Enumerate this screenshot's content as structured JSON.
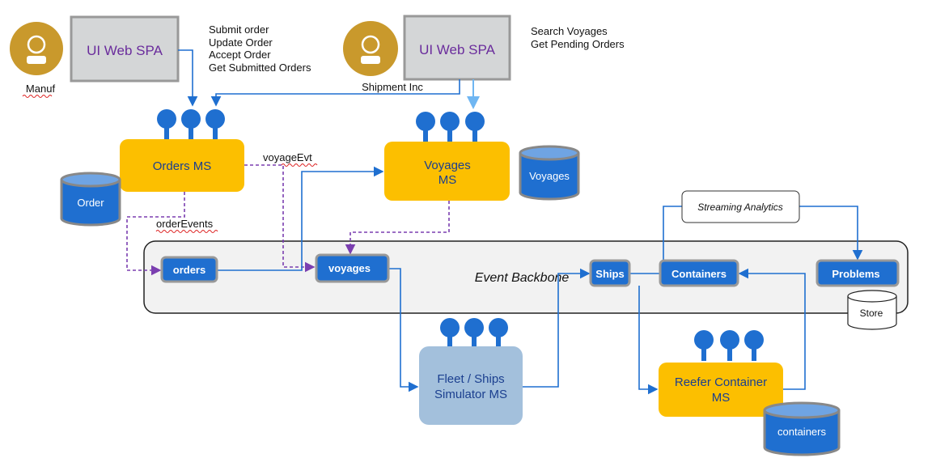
{
  "actors": [
    {
      "name": "Manuf"
    },
    {
      "name": "Shipment Inc"
    }
  ],
  "spa": [
    {
      "label": "UI Web SPA"
    },
    {
      "label": "UI Web SPA"
    }
  ],
  "orders_ops": [
    "Submit order",
    "Update Order",
    "Accept Order",
    "Get Submitted Orders"
  ],
  "voyages_ops": [
    "Search Voyages",
    "Get Pending Orders"
  ],
  "services": {
    "orders": "Orders MS",
    "voyages": [
      "Voyages",
      "MS"
    ],
    "fleet": [
      "Fleet / Ships",
      "Simulator MS"
    ],
    "reefer": [
      "Reefer Container",
      "MS"
    ],
    "analytics": "Streaming Analytics"
  },
  "databases": {
    "order": "Order",
    "voyages": "Voyages",
    "containers": "containers",
    "store": "Store"
  },
  "backbone": {
    "title": "Event Backbone",
    "topics": [
      "orders",
      "voyages",
      "Ships",
      "Containers",
      "Problems"
    ]
  },
  "events": {
    "voyage": "voyageEvt",
    "order": "orderEvents"
  },
  "colors": {
    "microservice": "#fcbf00",
    "simulator": "#a3c0dc",
    "topic": "#1f6fd0",
    "actor": "#c9992c",
    "spa": "#d4d6d7",
    "async_event": "#7b3fb0"
  }
}
